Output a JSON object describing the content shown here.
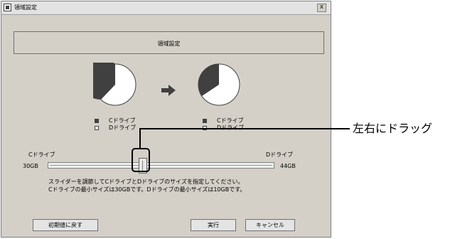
{
  "window": {
    "title": "領域設定",
    "close_label": "x"
  },
  "heading": "領域設定",
  "colors": {
    "c_drive": "#404040",
    "d_drive": "#ffffff",
    "dialog_bg": "#d4d0c8"
  },
  "before": {
    "legend_c": "Cドライブ",
    "legend_d": "Dドライブ"
  },
  "after": {
    "legend_c": "Cドライブ",
    "legend_d": "Dドライブ"
  },
  "slider": {
    "left_label": "Cドライブ",
    "right_label": "Dドライブ",
    "min_label": "30GB",
    "max_label": "44GB"
  },
  "description": {
    "line1": "スライダーを調節してCドライブとDドライブのサイズを指定してください。",
    "line2": "Cドライブの最小サイズは30GBです。Dドライブの最小サイズは10GBです。"
  },
  "buttons": {
    "reset": "初期値に戻す",
    "execute": "実行",
    "cancel": "キャンセル"
  },
  "callout": "左右にドラッグ"
}
